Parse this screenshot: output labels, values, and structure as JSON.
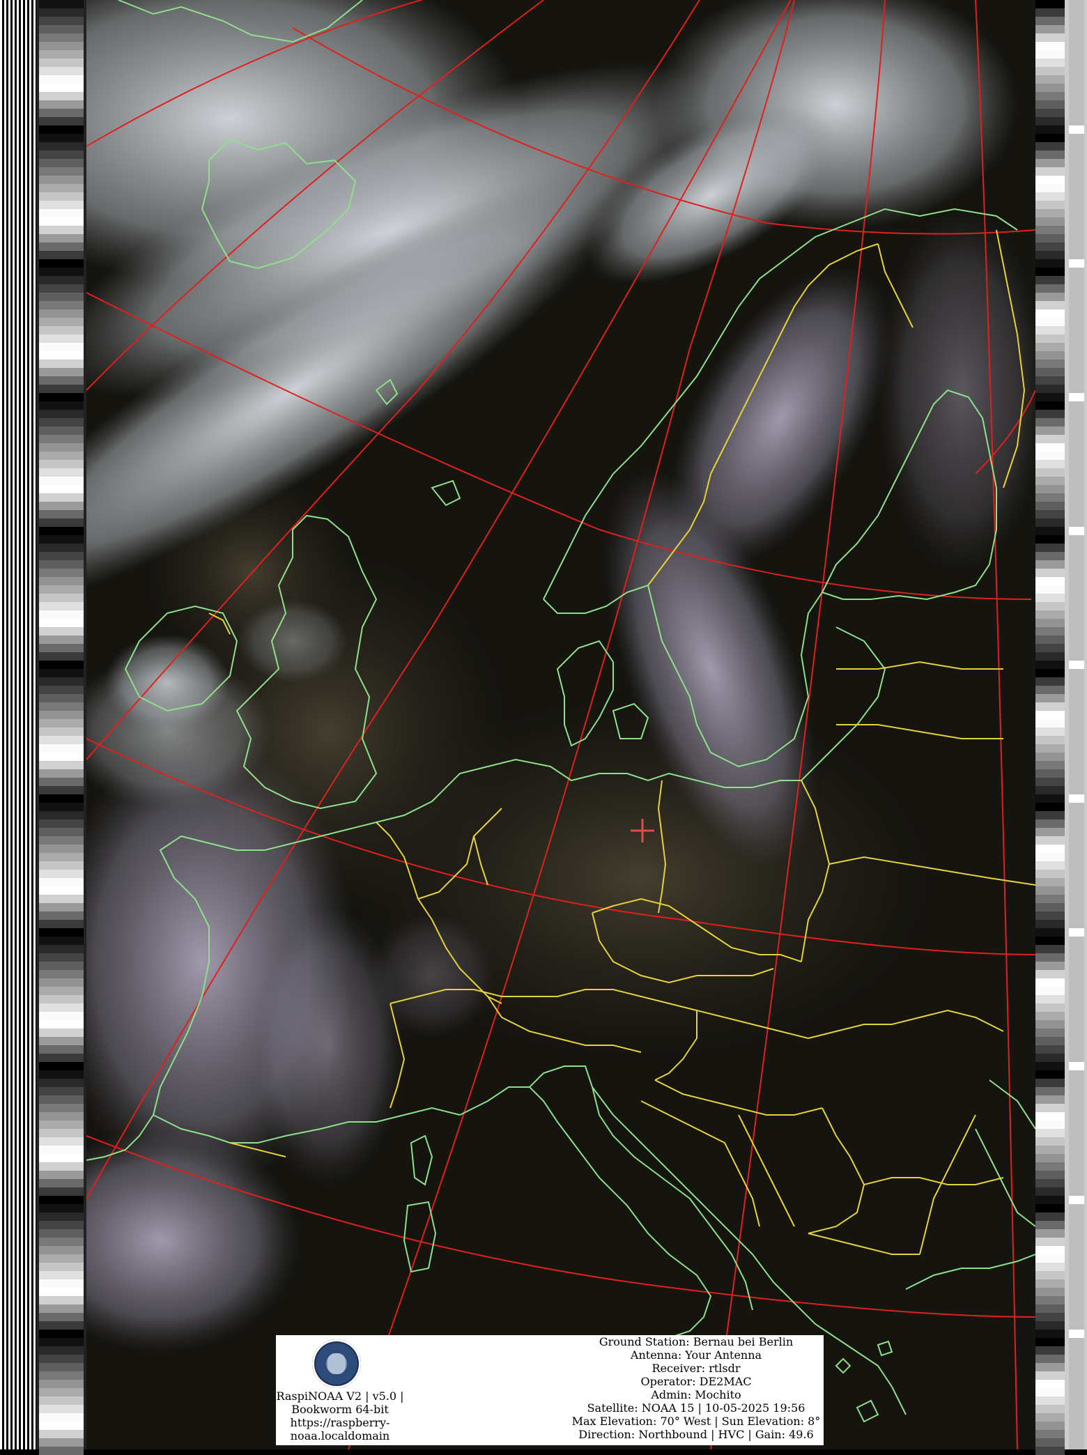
{
  "panel": {
    "system": {
      "version_line": "RaspiNOAA V2 | v5.0 |",
      "os_line": "Bookworm 64-bit",
      "url_line1": "https://raspberry-",
      "url_line2": "noaa.localdomain"
    },
    "pass_info": {
      "ground_station": "Ground Station: Bernau bei Berlin",
      "antenna": "Antenna: Your Antenna",
      "receiver": "Receiver: rtlsdr",
      "operator": "Operator: DE2MAC",
      "admin": "Admin: Mochito",
      "satellite": "Satellite: NOAA 15 | 10-05-2025 19:56",
      "elevation": "Max Elevation: 70° West | Sun Elevation: 8°",
      "direction": "Direction: Northbound | HVC | Gain: 49.6"
    },
    "logo_icon": "raspinoaa-logo-icon"
  },
  "map": {
    "icons": [
      "location-crosshair-icon"
    ],
    "colors": {
      "graticule": "#e0201c",
      "coastline": "#8fe08a",
      "borders": "#e6d23a",
      "marker": "#e04a4a",
      "dark_sea": "#15140f",
      "cloud": "#c9cdd3"
    }
  }
}
